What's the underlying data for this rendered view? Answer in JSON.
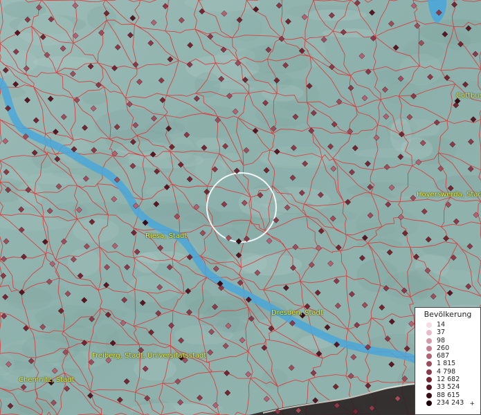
{
  "legend": {
    "title": "Bevölkerung",
    "plus": "+",
    "items": [
      {
        "label": "14",
        "color": "#f4dde4"
      },
      {
        "label": "37",
        "color": "#e6bccb"
      },
      {
        "label": "98",
        "color": "#d49aab"
      },
      {
        "label": "260",
        "color": "#c47e8f"
      },
      {
        "label": "687",
        "color": "#b26373"
      },
      {
        "label": "1 815",
        "color": "#9d4e5c"
      },
      {
        "label": "4 798",
        "color": "#8a3a48"
      },
      {
        "label": "12 682",
        "color": "#722733"
      },
      {
        "label": "33 524",
        "color": "#571824"
      },
      {
        "label": "88 615",
        "color": "#3a0c15"
      },
      {
        "label": "234 243",
        "color": "#1e0208"
      }
    ]
  },
  "cities": [
    {
      "id": "riesa",
      "label": "Riesa, Stadt"
    },
    {
      "id": "dresden",
      "label": "Dresden, Stadt"
    },
    {
      "id": "freiberg",
      "label": "Freiberg, Stadt, Universitätsstadt"
    },
    {
      "id": "chemnitz",
      "label": "Chemnitz, Stadt"
    },
    {
      "id": "cottbus",
      "label": "Cottbus"
    },
    {
      "id": "hoyerswerda",
      "label": "Hoyerswerda, Stadt"
    }
  ],
  "colors": {
    "background": "#8fb3ae",
    "boundary": "#e03030",
    "river": "#4aa7d8",
    "label": "#f2ec3a"
  }
}
